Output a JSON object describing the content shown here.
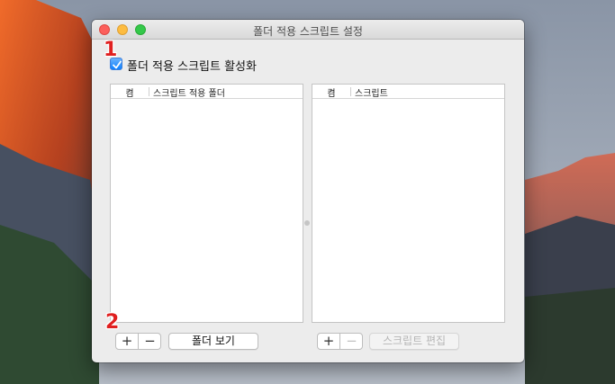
{
  "window": {
    "title": "폴더 적용 스크립트 설정"
  },
  "enable": {
    "label": "폴더 적용 스크립트 활성화",
    "checked": true
  },
  "folders_table": {
    "col_on": "켬",
    "col_name": "스크립트 적용 폴더"
  },
  "scripts_table": {
    "col_on": "켬",
    "col_name": "스크립트"
  },
  "left_controls": {
    "add_label": "+",
    "remove_label": "−",
    "show_folder_label": "폴더 보기"
  },
  "right_controls": {
    "add_label": "+",
    "remove_label": "−",
    "edit_script_label": "스크립트 편집"
  },
  "annotations": {
    "marker1": "1",
    "marker2": "2"
  },
  "colors": {
    "accent": "#0d81ff",
    "marker": "#e02020"
  }
}
